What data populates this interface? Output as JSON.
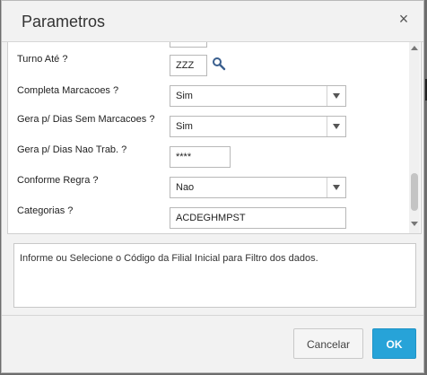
{
  "dialog": {
    "title": "Parametros",
    "close_glyph": "×"
  },
  "fields": [
    {
      "label": "Turno Até ?",
      "type": "lookup",
      "value": "ZZZ",
      "icon": "search-icon"
    },
    {
      "label": "Completa Marcacoes ?",
      "type": "select",
      "value": "Sim"
    },
    {
      "label": "Gera p/ Dias Sem Marcacoes ?",
      "type": "select",
      "value": "Sim"
    },
    {
      "label": "Gera p/ Dias Nao Trab. ?",
      "type": "text",
      "value": "****"
    },
    {
      "label": "Conforme Regra ?",
      "type": "select",
      "value": "Nao"
    },
    {
      "label": "Categorias ?",
      "type": "text",
      "value": "ACDEGHMPST"
    }
  ],
  "help_text": "Informe ou Selecione o Código da Filial Inicial para Filtro dos dados.",
  "buttons": {
    "cancel": "Cancelar",
    "ok": "OK"
  },
  "colors": {
    "accent": "#27a3d8",
    "dialog_bg": "#f2f2f2",
    "backdrop": "#6d6d6d"
  }
}
